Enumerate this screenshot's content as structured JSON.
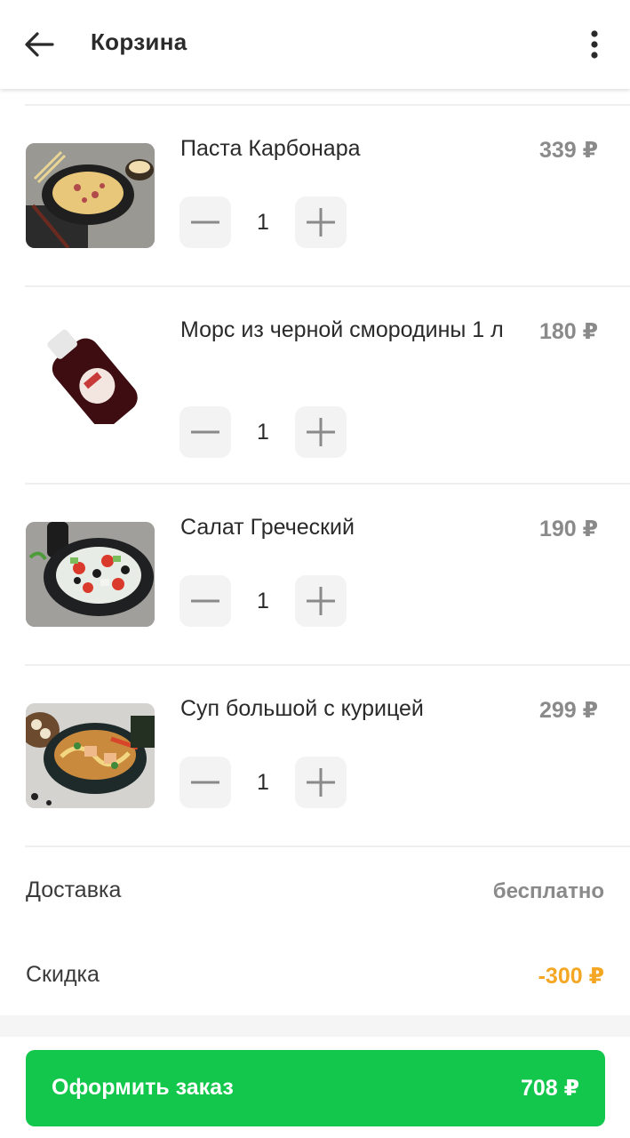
{
  "header": {
    "title": "Корзина",
    "back_icon": "arrow-left-icon",
    "menu_icon": "more-vertical-icon"
  },
  "items": [
    {
      "name": "Паста Карбонара",
      "price": "339 ₽",
      "qty": "1"
    },
    {
      "name": "Морс из черной смородины 1 л",
      "price": "180 ₽",
      "qty": "1"
    },
    {
      "name": "Салат Греческий",
      "price": "190 ₽",
      "qty": "1"
    },
    {
      "name": "Суп большой с курицей",
      "price": "299 ₽",
      "qty": "1"
    }
  ],
  "summary": {
    "delivery_label": "Доставка",
    "delivery_value": "бесплатно",
    "discount_label": "Скидка",
    "discount_value": "-300 ₽"
  },
  "checkout": {
    "label": "Оформить заказ",
    "total": "708 ₽"
  },
  "colors": {
    "accent_green": "#12c74c",
    "discount_orange": "#f5a623",
    "muted_gray": "#8a8a8a"
  }
}
